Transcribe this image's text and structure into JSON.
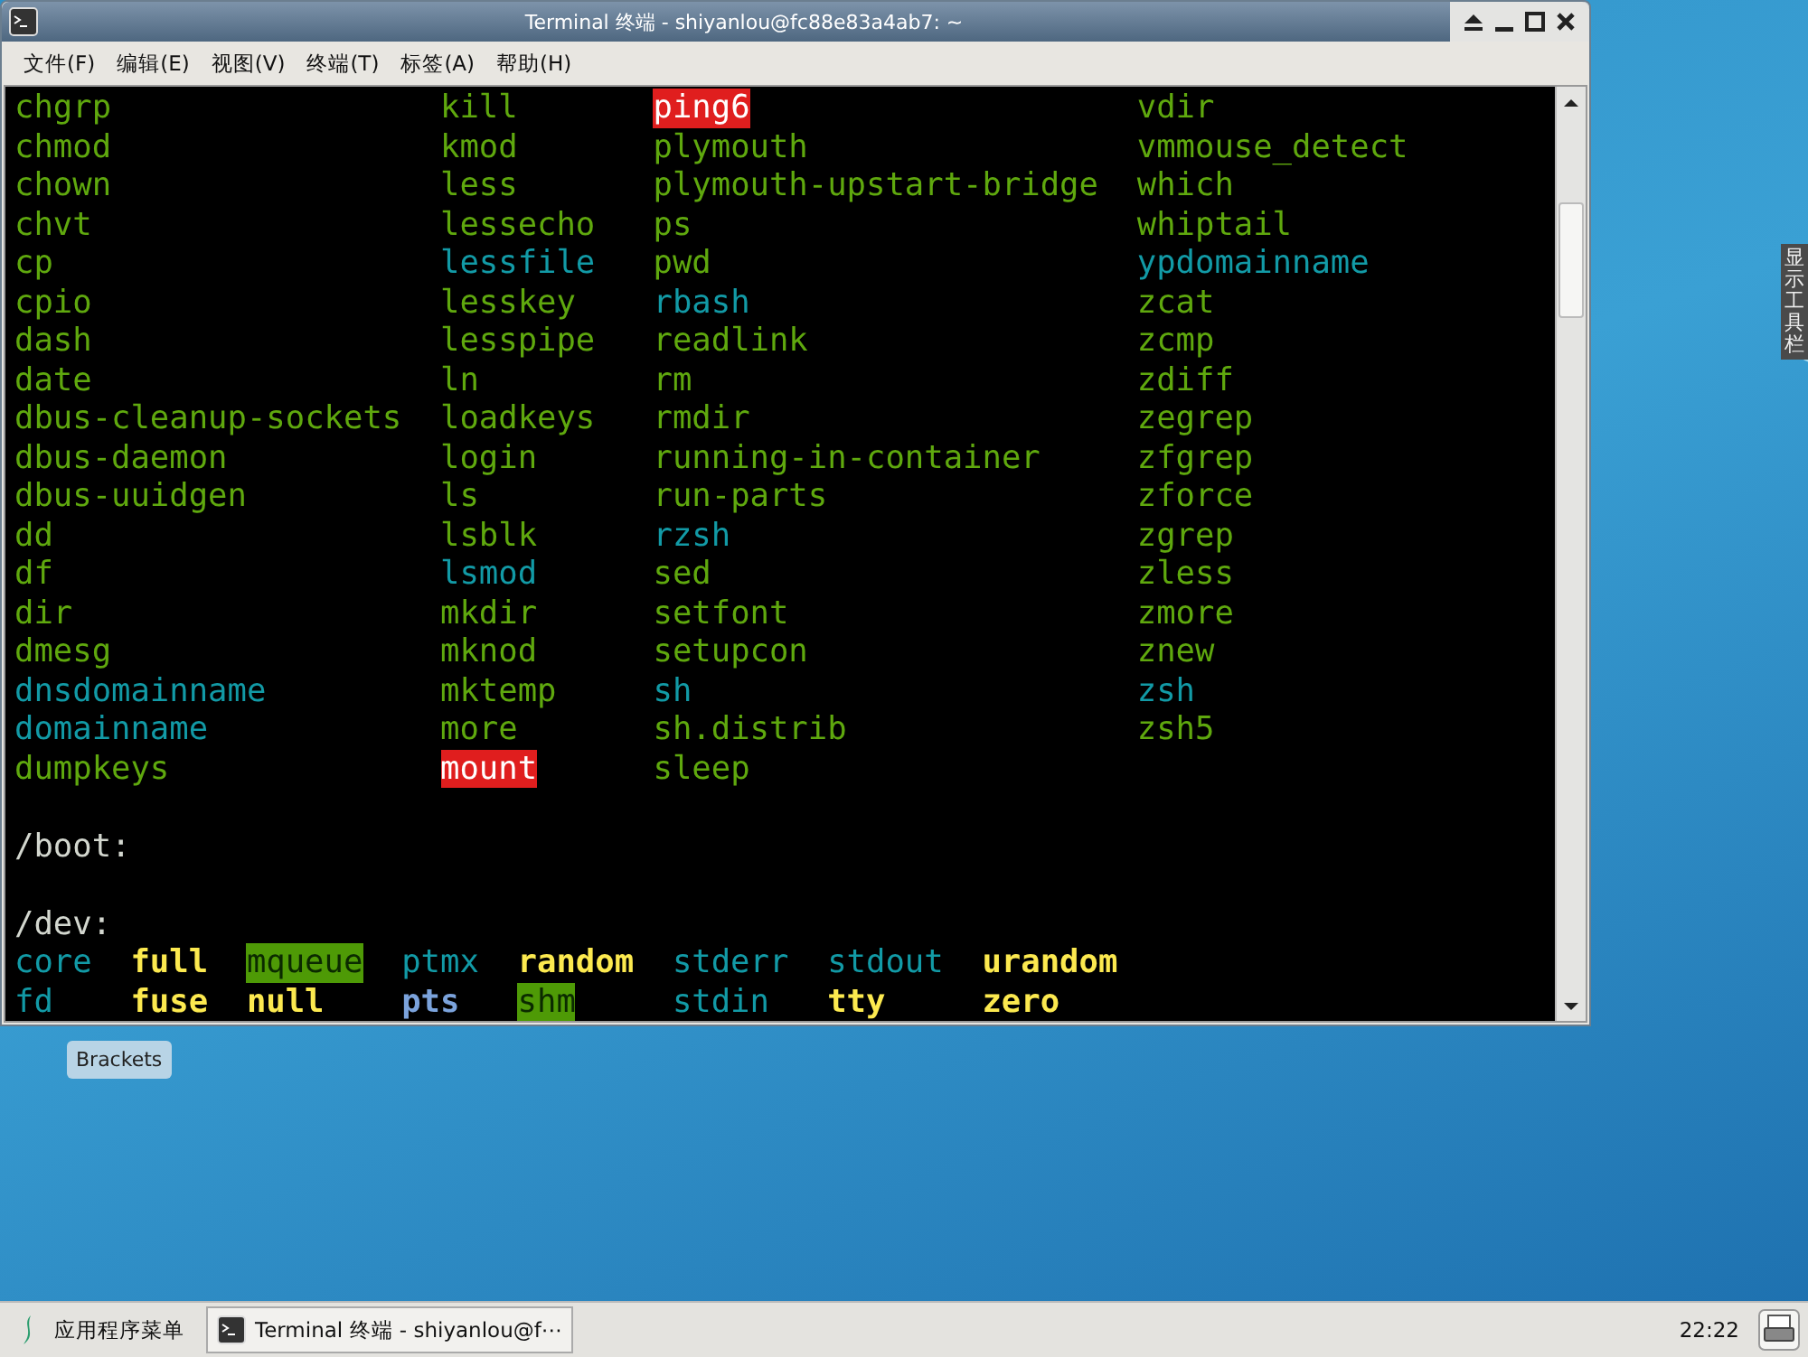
{
  "window": {
    "title": "Terminal 终端 - shiyanlou@fc88e83a4ab7: ~"
  },
  "menu": [
    "文件(F)",
    "编辑(E)",
    "视图(V)",
    "终端(T)",
    "标签(A)",
    "帮助(H)"
  ],
  "terminal": {
    "blocks": [
      {
        "kind": "listing",
        "columns": [
          [
            {
              "name": "chgrp",
              "kind": "exec"
            },
            {
              "name": "chmod",
              "kind": "exec"
            },
            {
              "name": "chown",
              "kind": "exec"
            },
            {
              "name": "chvt",
              "kind": "exec"
            },
            {
              "name": "cp",
              "kind": "exec"
            },
            {
              "name": "cpio",
              "kind": "exec"
            },
            {
              "name": "dash",
              "kind": "exec"
            },
            {
              "name": "date",
              "kind": "exec"
            },
            {
              "name": "dbus-cleanup-sockets",
              "kind": "exec"
            },
            {
              "name": "dbus-daemon",
              "kind": "exec"
            },
            {
              "name": "dbus-uuidgen",
              "kind": "exec"
            },
            {
              "name": "dd",
              "kind": "exec"
            },
            {
              "name": "df",
              "kind": "exec"
            },
            {
              "name": "dir",
              "kind": "exec"
            },
            {
              "name": "dmesg",
              "kind": "exec"
            },
            {
              "name": "dnsdomainname",
              "kind": "link"
            },
            {
              "name": "domainname",
              "kind": "link"
            },
            {
              "name": "dumpkeys",
              "kind": "exec"
            }
          ],
          [
            {
              "name": "kill",
              "kind": "exec"
            },
            {
              "name": "kmod",
              "kind": "exec"
            },
            {
              "name": "less",
              "kind": "exec"
            },
            {
              "name": "lessecho",
              "kind": "exec"
            },
            {
              "name": "lessfile",
              "kind": "link"
            },
            {
              "name": "lesskey",
              "kind": "exec"
            },
            {
              "name": "lesspipe",
              "kind": "exec"
            },
            {
              "name": "ln",
              "kind": "exec"
            },
            {
              "name": "loadkeys",
              "kind": "exec"
            },
            {
              "name": "login",
              "kind": "exec"
            },
            {
              "name": "ls",
              "kind": "exec"
            },
            {
              "name": "lsblk",
              "kind": "exec"
            },
            {
              "name": "lsmod",
              "kind": "link"
            },
            {
              "name": "mkdir",
              "kind": "exec"
            },
            {
              "name": "mknod",
              "kind": "exec"
            },
            {
              "name": "mktemp",
              "kind": "exec"
            },
            {
              "name": "more",
              "kind": "exec"
            },
            {
              "name": "mount",
              "kind": "setuid"
            }
          ],
          [
            {
              "name": "ping6",
              "kind": "setuid"
            },
            {
              "name": "plymouth",
              "kind": "exec"
            },
            {
              "name": "plymouth-upstart-bridge",
              "kind": "exec"
            },
            {
              "name": "ps",
              "kind": "exec"
            },
            {
              "name": "pwd",
              "kind": "exec"
            },
            {
              "name": "rbash",
              "kind": "link"
            },
            {
              "name": "readlink",
              "kind": "exec"
            },
            {
              "name": "rm",
              "kind": "exec"
            },
            {
              "name": "rmdir",
              "kind": "exec"
            },
            {
              "name": "running-in-container",
              "kind": "exec"
            },
            {
              "name": "run-parts",
              "kind": "exec"
            },
            {
              "name": "rzsh",
              "kind": "link"
            },
            {
              "name": "sed",
              "kind": "exec"
            },
            {
              "name": "setfont",
              "kind": "exec"
            },
            {
              "name": "setupcon",
              "kind": "exec"
            },
            {
              "name": "sh",
              "kind": "link"
            },
            {
              "name": "sh.distrib",
              "kind": "exec"
            },
            {
              "name": "sleep",
              "kind": "exec"
            }
          ],
          [
            {
              "name": "vdir",
              "kind": "exec"
            },
            {
              "name": "vmmouse_detect",
              "kind": "exec"
            },
            {
              "name": "which",
              "kind": "exec"
            },
            {
              "name": "whiptail",
              "kind": "exec"
            },
            {
              "name": "ypdomainname",
              "kind": "link"
            },
            {
              "name": "zcat",
              "kind": "exec"
            },
            {
              "name": "zcmp",
              "kind": "exec"
            },
            {
              "name": "zdiff",
              "kind": "exec"
            },
            {
              "name": "zegrep",
              "kind": "exec"
            },
            {
              "name": "zfgrep",
              "kind": "exec"
            },
            {
              "name": "zforce",
              "kind": "exec"
            },
            {
              "name": "zgrep",
              "kind": "exec"
            },
            {
              "name": "zless",
              "kind": "exec"
            },
            {
              "name": "zmore",
              "kind": "exec"
            },
            {
              "name": "znew",
              "kind": "exec"
            },
            {
              "name": "zsh",
              "kind": "link"
            },
            {
              "name": "zsh5",
              "kind": "exec"
            }
          ]
        ]
      },
      {
        "kind": "heading",
        "text": "/boot:"
      },
      {
        "kind": "heading",
        "text": "/dev:"
      },
      {
        "kind": "listing",
        "columns": [
          [
            {
              "name": "core",
              "kind": "link"
            },
            {
              "name": "fd",
              "kind": "link"
            }
          ],
          [
            {
              "name": "full",
              "kind": "device"
            },
            {
              "name": "fuse",
              "kind": "device"
            }
          ],
          [
            {
              "name": "mqueue",
              "kind": "sticky"
            },
            {
              "name": "null",
              "kind": "device"
            }
          ],
          [
            {
              "name": "ptmx",
              "kind": "link"
            },
            {
              "name": "pts",
              "kind": "dir"
            }
          ],
          [
            {
              "name": "random",
              "kind": "device"
            },
            {
              "name": "shm",
              "kind": "sticky"
            }
          ],
          [
            {
              "name": "stderr",
              "kind": "link"
            },
            {
              "name": "stdin",
              "kind": "link"
            }
          ],
          [
            {
              "name": "stdout",
              "kind": "link"
            },
            {
              "name": "tty",
              "kind": "device"
            }
          ],
          [
            {
              "name": "urandom",
              "kind": "device"
            },
            {
              "name": "zero",
              "kind": "device"
            }
          ]
        ]
      }
    ]
  },
  "desktop": {
    "icons": [
      {
        "label": "Brackets"
      }
    ],
    "side_tab": "显示工具栏"
  },
  "taskbar": {
    "start": "应用程序菜单",
    "tasks": [
      {
        "label": "Terminal 终端 - shiyanlou@f⋯"
      }
    ],
    "clock": "22:22"
  }
}
